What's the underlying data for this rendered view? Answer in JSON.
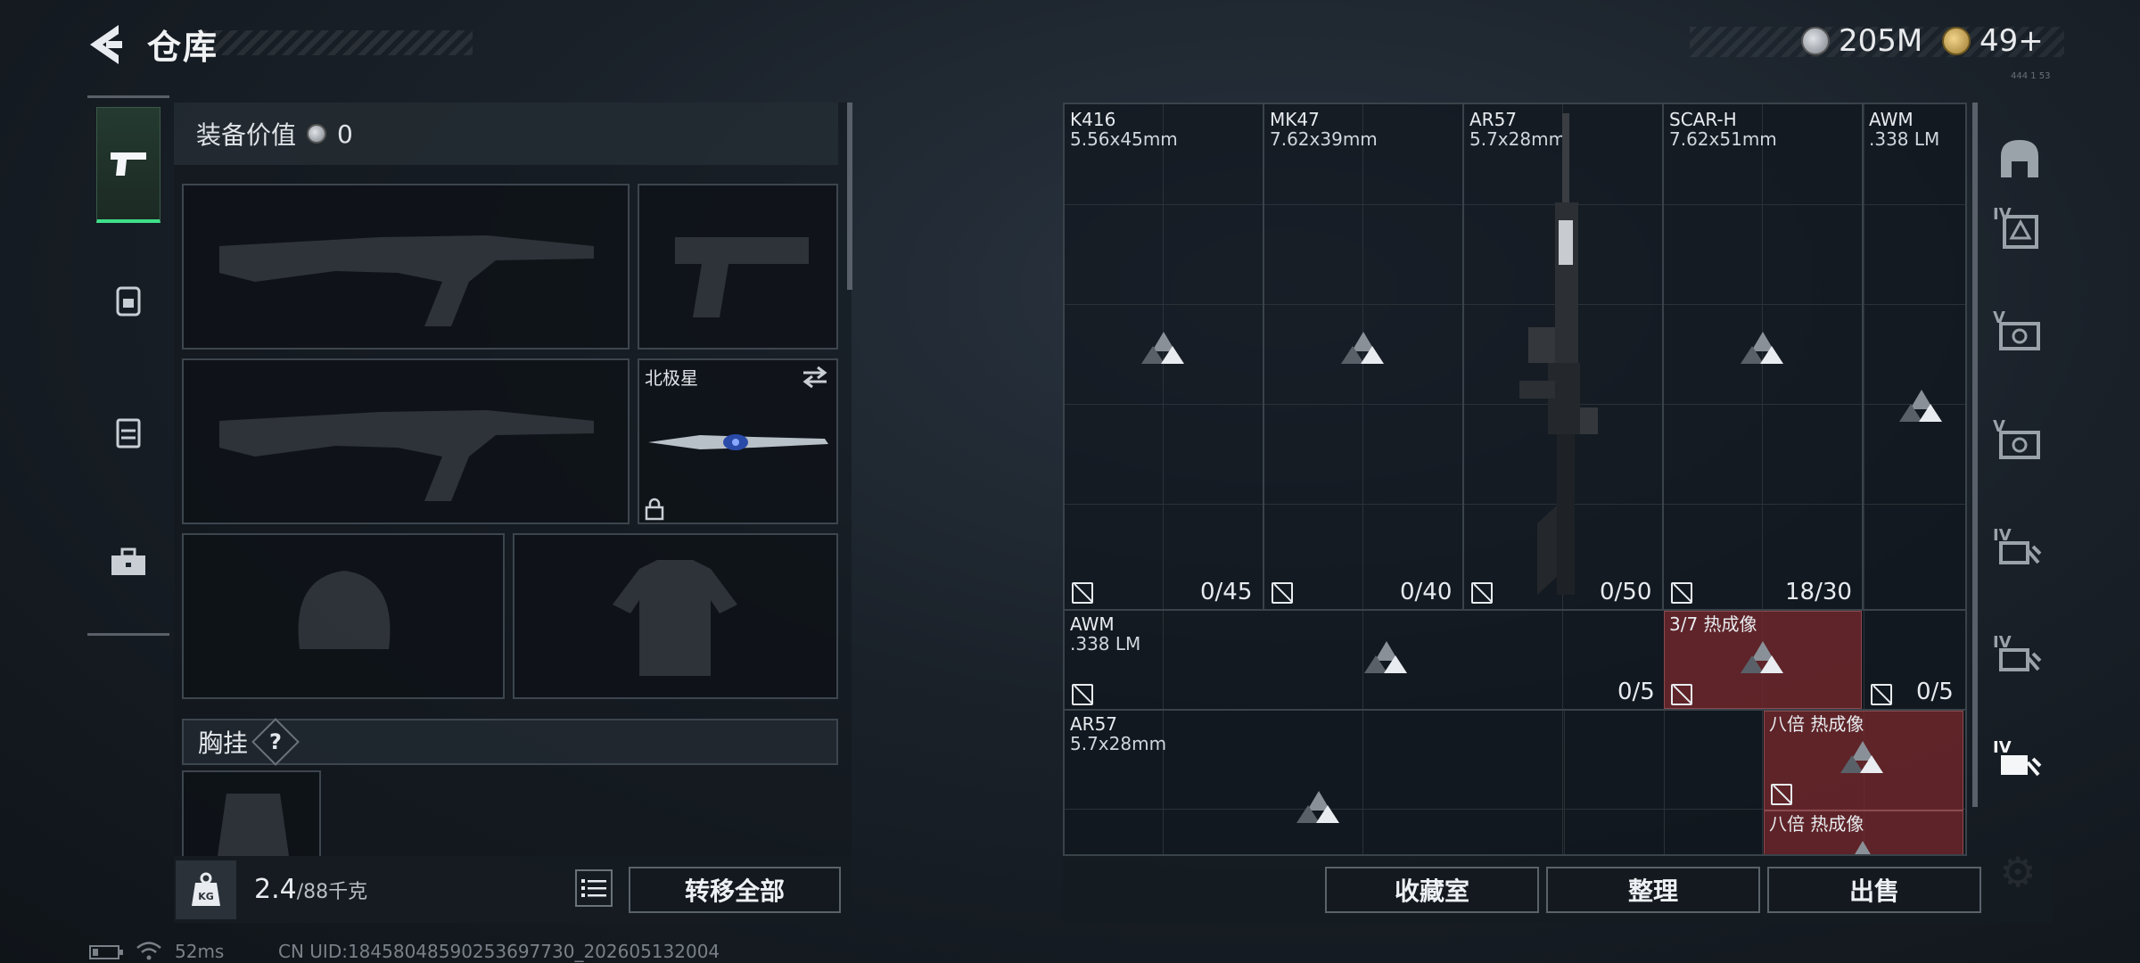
{
  "header": {
    "title": "仓库",
    "currency_silver": "205M",
    "currency_gold": "49+",
    "tiny_code": "444 1 53"
  },
  "left_rail": {
    "items": [
      {
        "icon": "pistol-icon",
        "active": true
      },
      {
        "icon": "backpack-icon",
        "active": false
      },
      {
        "icon": "vest-icon",
        "active": false
      },
      {
        "icon": "toolbox-icon",
        "active": false
      }
    ]
  },
  "loadout": {
    "value_label": "装备价值",
    "value": "0",
    "melee_name": "北极星",
    "chest_rig_label": "胸挂",
    "chest_rig_help": "?"
  },
  "bottom_left": {
    "weight": "2.4",
    "weight_max": "/88千克",
    "transfer_all": "转移全部"
  },
  "status_bar": {
    "ping": "52ms",
    "uid": "CN UID:18458048590253697730_202605132004"
  },
  "grid": {
    "row1": [
      {
        "name": "K416",
        "caliber": "5.56x45mm",
        "count": "0/45"
      },
      {
        "name": "MK47",
        "caliber": "7.62x39mm",
        "count": "0/40"
      },
      {
        "name": "AR57",
        "caliber": "5.7x28mm",
        "count": "0/50"
      },
      {
        "name": "SCAR-H",
        "caliber": "7.62x51mm",
        "count": "18/30"
      },
      {
        "name": "AWM",
        "caliber": ".338 LM"
      }
    ],
    "row2": [
      {
        "name": "AWM",
        "caliber": ".338 LM",
        "count": "0/5"
      },
      {
        "name": "3/7 热成像"
      },
      {
        "count": "0/5"
      }
    ],
    "row3": [
      {
        "name": "AR57",
        "caliber": "5.7x28mm"
      },
      {
        "name": "八倍 热成像"
      },
      {
        "name": "八倍 热成像"
      }
    ]
  },
  "right_rail": {
    "items": [
      {
        "icon": "helmet-icon",
        "tier": ""
      },
      {
        "icon": "armor-tier-icon",
        "tier": "IV"
      },
      {
        "icon": "case-tier-icon",
        "tier": "V"
      },
      {
        "icon": "case-tier-icon",
        "tier": "V"
      },
      {
        "icon": "weapon-case-icon",
        "tier": "IV"
      },
      {
        "icon": "weapon-case-icon",
        "tier": "IV"
      },
      {
        "icon": "weapon-case-icon",
        "tier": "IV"
      }
    ]
  },
  "bottom_right": {
    "collection": "收藏室",
    "sort": "整理",
    "sell": "出售"
  },
  "colors": {
    "accent_green": "#3ee08a",
    "thermal_red": "#782c30"
  }
}
